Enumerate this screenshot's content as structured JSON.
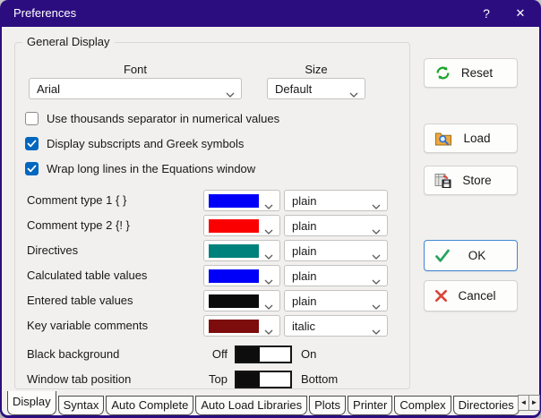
{
  "window": {
    "title": "Preferences",
    "help": "?",
    "close": "✕"
  },
  "panel": {
    "group_title": "General Display"
  },
  "font_select": {
    "label": "Font",
    "value": "Arial"
  },
  "size_select": {
    "label": "Size",
    "value": "Default"
  },
  "checkboxes": [
    {
      "label": "Use thousands separator in numerical values",
      "checked": false
    },
    {
      "label": "Display subscripts and Greek symbols",
      "checked": true
    },
    {
      "label": "Wrap long lines in the Equations window",
      "checked": true
    }
  ],
  "style_rows": [
    {
      "label": "Comment type 1 { }",
      "color": "#0000f8",
      "style": "plain"
    },
    {
      "label": "Comment type 2 {! }",
      "color": "#fb0000",
      "style": "plain"
    },
    {
      "label": "Directives",
      "color": "#00827c",
      "style": "plain"
    },
    {
      "label": "Calculated table values",
      "color": "#0000f8",
      "style": "plain"
    },
    {
      "label": "Entered table values",
      "color": "#0b0b0b",
      "style": "plain"
    },
    {
      "label": "Key variable comments",
      "color": "#7d0c0c",
      "style": "italic"
    }
  ],
  "toggle_rows": [
    {
      "label": "Black background",
      "left_label": "Off",
      "right_label": "On",
      "state": "left"
    },
    {
      "label": "Window tab position",
      "left_label": "Top",
      "right_label": "Bottom",
      "state": "left"
    }
  ],
  "action_buttons": {
    "reset": "Reset",
    "load": "Load",
    "store": "Store",
    "ok": "OK",
    "cancel": "Cancel"
  },
  "tab_bar": {
    "tabs": [
      "Display",
      "Syntax",
      "Auto Complete",
      "Auto Load Libraries",
      "Plots",
      "Printer",
      "Complex",
      "Directories"
    ],
    "active_tab": "Display",
    "scroll_left": "◄",
    "scroll_right": "►"
  },
  "colors": {
    "titlebar": "#2c0d80",
    "checkbox_accent": "#0067c0",
    "ok_border": "#3f87d6",
    "reset_icon_green": "#1aa42b",
    "ok_check_green": "#27a35e",
    "cancel_x_red": "#d8473b"
  }
}
